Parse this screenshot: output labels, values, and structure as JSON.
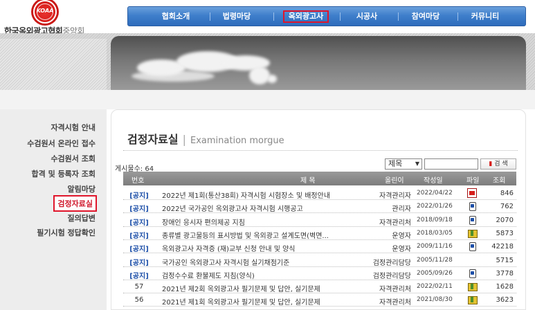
{
  "logo": {
    "mark_text": "KOAA",
    "name_part1": "한국옥외광고협회",
    "name_part2": "중앙회"
  },
  "gnb": {
    "items": [
      {
        "label": "협회소개"
      },
      {
        "label": "법령마당"
      },
      {
        "label": "옥외광고사",
        "active": true
      },
      {
        "label": "시공사"
      },
      {
        "label": "참여마당"
      },
      {
        "label": "커뮤니티"
      }
    ]
  },
  "lnb": {
    "items": [
      {
        "label": "자격시험 안내"
      },
      {
        "label": "수검원서 온라인 접수"
      },
      {
        "label": "수검원서 조회"
      },
      {
        "label": "합격 및 등록자 조회"
      },
      {
        "label": "알림마당"
      },
      {
        "label": "검정자료실",
        "active": true
      },
      {
        "label": "질의답변"
      },
      {
        "label": "필기시험 정답확인"
      }
    ]
  },
  "page": {
    "title": "검정자료실",
    "subtitle": "Examination morgue",
    "count_label": "게시물수: 64"
  },
  "search": {
    "select_value": "제목",
    "input_value": "",
    "button_label": "검 색"
  },
  "table": {
    "headers": [
      "번호",
      "제 목",
      "올린이",
      "작성일",
      "파일",
      "조회"
    ],
    "rows": [
      {
        "no": "[공지]",
        "notice": true,
        "title": "2022년 제1회(통산38회) 자격시험 시험장소 및 배정안내",
        "author": "자격관리자",
        "date": "2022/04/22",
        "file": "pdf-icon",
        "views": "846"
      },
      {
        "no": "[공지]",
        "notice": true,
        "title": "2022년 국가공인 옥외광고사 자격시험 시행공고",
        "author": "관리자",
        "date": "2022/01/26",
        "file": "hwp-icon",
        "views": "762"
      },
      {
        "no": "[공지]",
        "notice": true,
        "title": "장애인 응시자 편의제공 지침",
        "author": "자격관리처",
        "date": "2018/09/18",
        "file": "hwp-icon",
        "views": "2070"
      },
      {
        "no": "[공지]",
        "notice": true,
        "title": "종류별 광고물등의 표시방법 및 옥외광고 설계도면(벽면...",
        "author": "운영자",
        "date": "2018/03/05",
        "file": "zip-icon",
        "views": "5873"
      },
      {
        "no": "[공지]",
        "notice": true,
        "title": "옥외광고사 자격증 (재)교부 신청 안내 및 양식",
        "author": "운영자",
        "date": "2009/11/16",
        "file": "hwp-icon",
        "views": "42218"
      },
      {
        "no": "[공지]",
        "notice": true,
        "title": "국가공인 옥외광고사 자격시험 실기채점기준",
        "author": "검정관리담당",
        "date": "2005/11/28",
        "file": "",
        "views": "5715"
      },
      {
        "no": "[공지]",
        "notice": true,
        "title": "검정수수료 환불제도 지침(양식)",
        "author": "검정관리담당",
        "date": "2005/09/26",
        "file": "hwp-icon",
        "views": "3778"
      },
      {
        "no": "57",
        "notice": false,
        "title": "2021년 제2회 옥외광고사 필기문제 및 답안, 실기문제",
        "author": "자격관리처",
        "date": "2022/02/11",
        "file": "zip-icon",
        "views": "1628"
      },
      {
        "no": "56",
        "notice": false,
        "title": "2021년 제1회 옥외광고사 필기문제 및 답안, 실기문제",
        "author": "자격관리처",
        "date": "2021/08/30",
        "file": "zip-icon",
        "views": "3623"
      }
    ]
  }
}
